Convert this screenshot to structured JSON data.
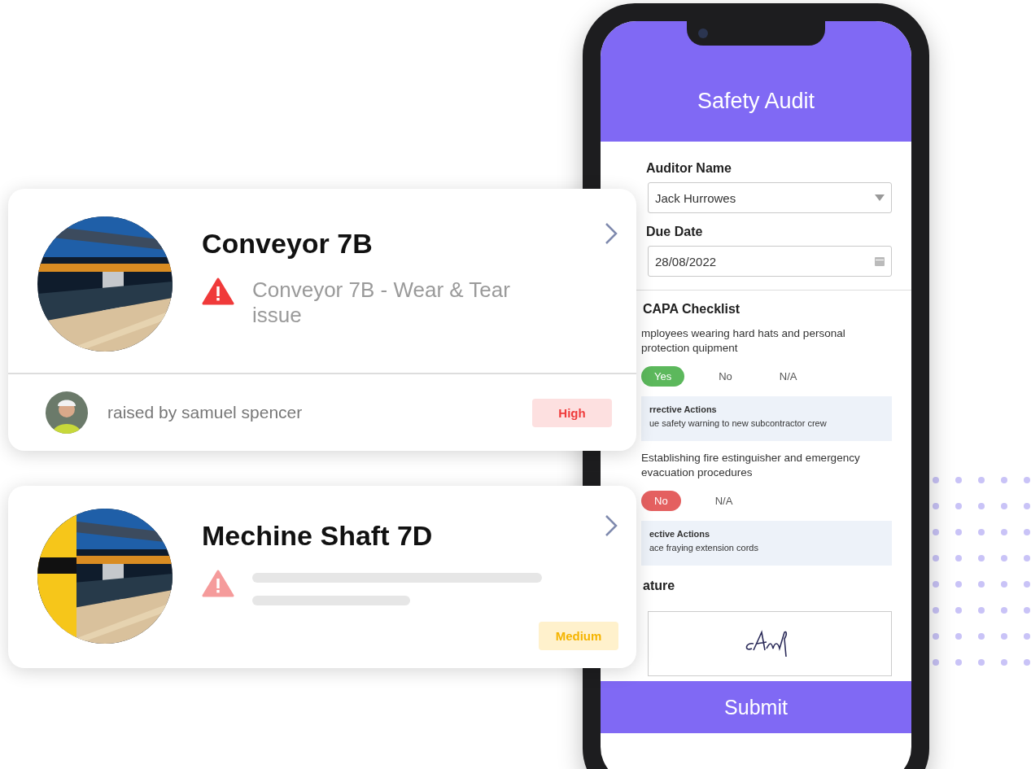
{
  "cards": [
    {
      "title": "Conveyor 7B",
      "issue": {
        "kind": "text",
        "text": "Conveyor 7B - Wear & Tear issue"
      },
      "raised_by": "raised by samuel spencer",
      "priority": {
        "label": "High",
        "kind": "high"
      }
    },
    {
      "title": "Mechine Shaft 7D",
      "issue": {
        "kind": "loading"
      },
      "priority": {
        "label": "Medium",
        "kind": "medium"
      }
    }
  ],
  "phone": {
    "title": "Safety Audit",
    "fields": [
      {
        "label": "Auditor Name",
        "value": "Jack Hurrowes",
        "kind": "select"
      },
      {
        "label": "Due Date",
        "value": "28/08/2022",
        "kind": "date"
      }
    ],
    "checklist": {
      "title": "CAPA Checklist",
      "items": [
        {
          "question": "mployees wearing hard hats and personal protection quipment",
          "options": [
            {
              "label": "Yes",
              "kind": "yes",
              "selected": true
            },
            {
              "label": "No",
              "kind": "no",
              "selected": false
            },
            {
              "label": "N/A",
              "kind": "na",
              "selected": false
            }
          ],
          "actions_title": "rrective Actions",
          "actions": "ue safety warning to new subcontractor crew"
        },
        {
          "question": "Establishing fire estinguisher and emergency evacuation procedures",
          "options": [
            {
              "label": "No",
              "kind": "no",
              "selected": true
            },
            {
              "label": "N/A",
              "kind": "na",
              "selected": false
            }
          ],
          "actions_title": "ective Actions",
          "actions": "ace fraying extension cords"
        }
      ]
    },
    "signature_label": "ature",
    "submit": "Submit"
  }
}
